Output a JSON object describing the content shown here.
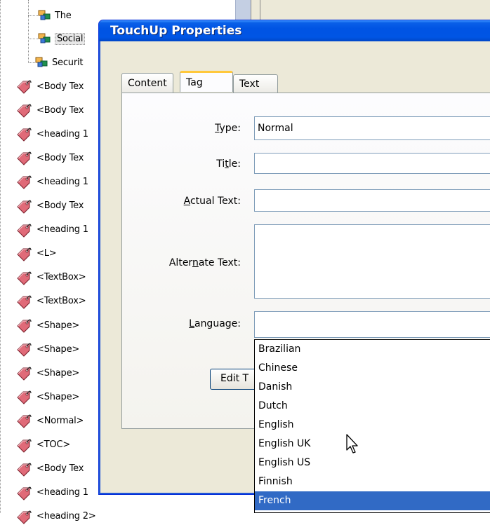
{
  "dialog": {
    "title": "TouchUp Properties",
    "tabs": [
      {
        "label": "Content"
      },
      {
        "label": "Tag",
        "active": true
      },
      {
        "label": "Text"
      }
    ],
    "fields": {
      "type": {
        "label": "Type:",
        "value": "Normal"
      },
      "title": {
        "label": "Title:",
        "value": ""
      },
      "actual_text": {
        "label": "Actual Text:",
        "value": ""
      },
      "alternate_text": {
        "label": "Alternate Text:",
        "value": ""
      },
      "language": {
        "label": "Language:",
        "value": ""
      }
    },
    "edit_button_label": "Edit T",
    "language_options": [
      "Brazilian",
      "Chinese",
      "Danish",
      "Dutch",
      "English",
      "English UK",
      "English US",
      "Finnish",
      "French"
    ],
    "selected_language": "French"
  },
  "tree": {
    "nodes": [
      {
        "label": "The",
        "kind": "node"
      },
      {
        "label": "Social",
        "kind": "node",
        "selected": true
      },
      {
        "label": "Securit",
        "kind": "node"
      },
      {
        "label": "<Body Tex",
        "kind": "tag"
      },
      {
        "label": "<Body Tex",
        "kind": "tag"
      },
      {
        "label": "<heading 1",
        "kind": "tag"
      },
      {
        "label": "<Body Tex",
        "kind": "tag"
      },
      {
        "label": "<heading 1",
        "kind": "tag"
      },
      {
        "label": "<Body Tex",
        "kind": "tag"
      },
      {
        "label": "<heading 1",
        "kind": "tag"
      },
      {
        "label": "<L>",
        "kind": "tag"
      },
      {
        "label": "<TextBox>",
        "kind": "tag"
      },
      {
        "label": "<TextBox>",
        "kind": "tag"
      },
      {
        "label": "<Shape>",
        "kind": "tag"
      },
      {
        "label": "<Shape>",
        "kind": "tag"
      },
      {
        "label": "<Shape>",
        "kind": "tag"
      },
      {
        "label": "<Shape>",
        "kind": "tag"
      },
      {
        "label": "<Normal>",
        "kind": "tag"
      },
      {
        "label": "<TOC>",
        "kind": "tag"
      },
      {
        "label": "<Body Tex",
        "kind": "tag"
      },
      {
        "label": "<heading 1",
        "kind": "tag"
      },
      {
        "label": "<heading 2>",
        "kind": "tag"
      }
    ]
  },
  "colors": {
    "titlebar": "#0054e3",
    "selection": "#316ac5",
    "dialog_face": "#ece9d8",
    "tab_highlight": "#ffc83c"
  }
}
